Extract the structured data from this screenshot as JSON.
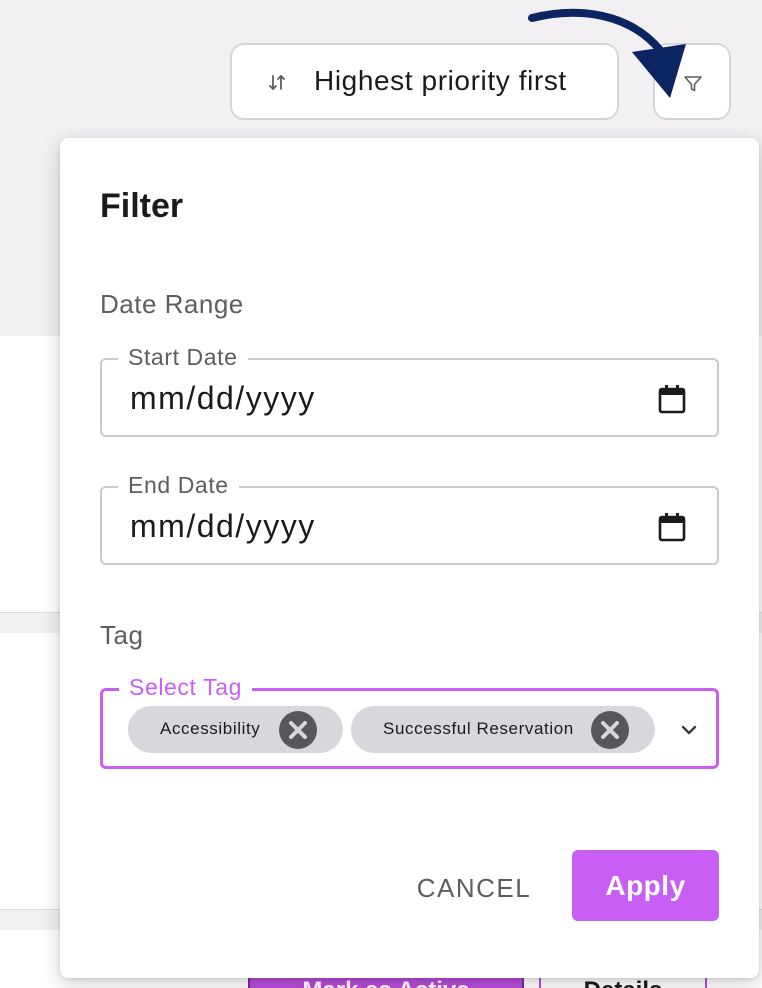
{
  "toolbar": {
    "sort_label": "Highest priority first",
    "sort_icon": "sort-arrows-icon",
    "filter_icon": "filter-funnel-icon"
  },
  "filter_panel": {
    "title": "Filter",
    "date_range_label": "Date Range",
    "start_date": {
      "label": "Start Date",
      "placeholder": "mm/dd/yyyy",
      "icon": "calendar-icon"
    },
    "end_date": {
      "label": "End Date",
      "placeholder": "mm/dd/yyyy",
      "icon": "calendar-icon"
    },
    "tag_section_label": "Tag",
    "tag_select": {
      "label": "Select Tag",
      "selected": [
        "Accessibility",
        "Successful Reservation"
      ],
      "remove_icon": "close-circle-icon",
      "dropdown_icon": "chevron-down-icon"
    },
    "cancel_label": "CANCEL",
    "apply_label": "Apply"
  },
  "background": {
    "active_button_label": "Mark as Active",
    "details_button_label": "Details"
  },
  "colors": {
    "accent": "#c95ef5",
    "annotation_arrow": "#0c2461",
    "page_bg": "#f2f0f3"
  }
}
